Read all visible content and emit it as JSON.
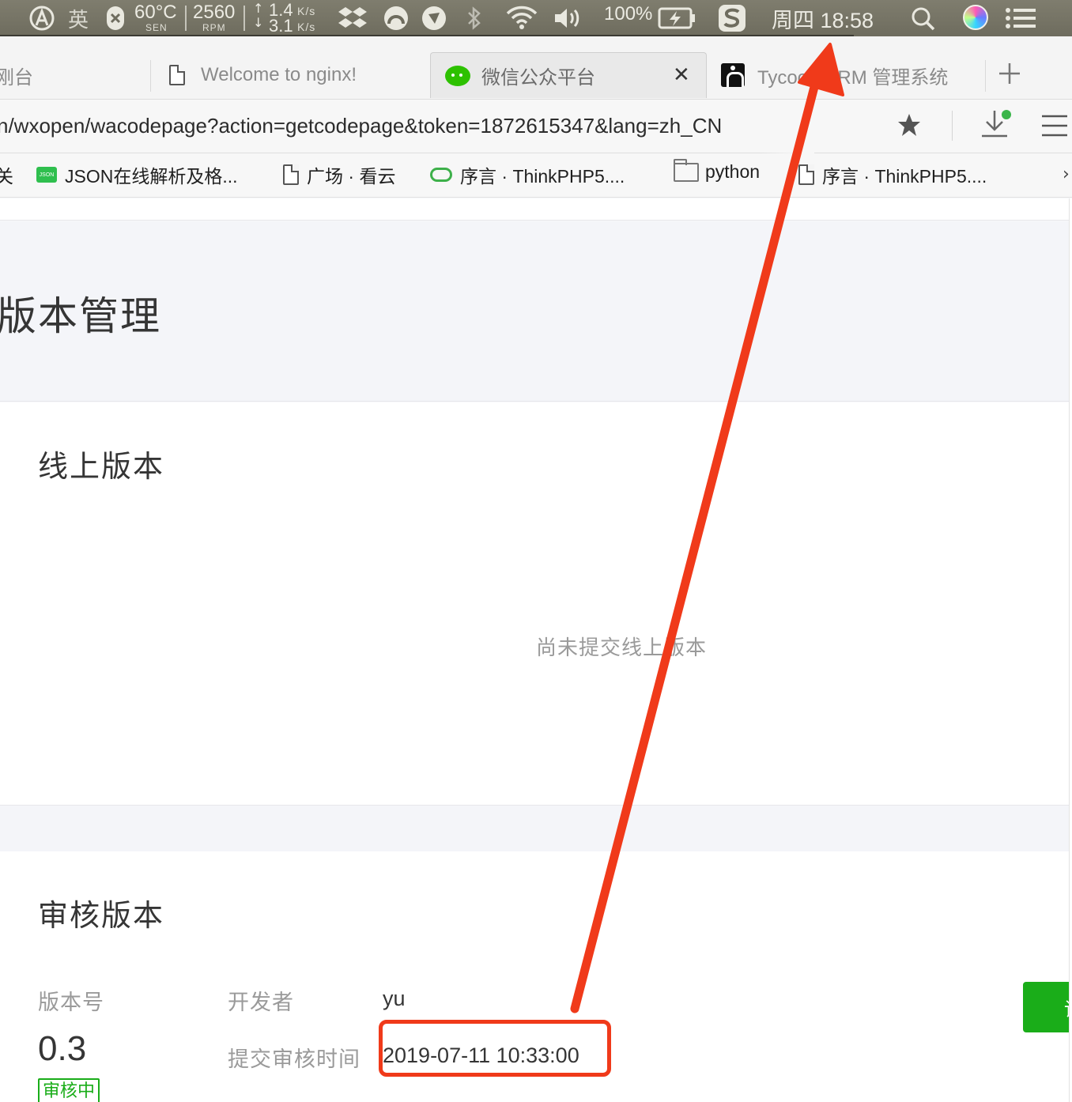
{
  "menubar": {
    "input_method": "英",
    "temperature": "60°C",
    "temperature_sub": "SEN",
    "fan_speed": "2560",
    "fan_sub": "RPM",
    "net_up": "1.4",
    "net_down": "3.1",
    "net_unit": "K/s",
    "battery": "100%",
    "datetime": "周四 18:58",
    "icons": [
      "alfred-icon",
      "close-badge-icon",
      "network-arrows-icon",
      "dropbox-icon",
      "cloud-sync-icon",
      "paw-icon",
      "bluetooth-icon",
      "wifi-icon",
      "volume-icon",
      "battery-charging-icon",
      "sogou-icon",
      "spotlight-search-icon",
      "siri-icon",
      "notification-list-icon"
    ]
  },
  "tabs": [
    {
      "label": "刚台",
      "active": false
    },
    {
      "label": "Welcome to nginx!",
      "active": false
    },
    {
      "label": "微信公众平台",
      "active": true
    },
    {
      "label": "Tycoon CRM 管理系统",
      "active": false
    }
  ],
  "address": {
    "url": "n/wxopen/wacodepage?action=getcodepage&token=1872615347&lang=zh_CN"
  },
  "bookmarks": [
    {
      "label": "关"
    },
    {
      "label": "JSON在线解析及格..."
    },
    {
      "label": "广场 · 看云"
    },
    {
      "label": "序言 · ThinkPHP5...."
    },
    {
      "label": "python"
    },
    {
      "label": "序言 · ThinkPHP5...."
    }
  ],
  "page": {
    "title": "版本管理",
    "online": {
      "title": "线上版本",
      "empty_tip": "尚未提交线上版本"
    },
    "review": {
      "title": "审核版本",
      "version_label": "版本号",
      "version": "0.3",
      "status": "审核中",
      "developer_label": "开发者",
      "developer": "yu",
      "submit_time_label": "提交审核时间",
      "submit_time": "2019-07-11 10:33:00",
      "action_button": "详"
    }
  },
  "colors": {
    "accent_green": "#1aad19",
    "annotation_red": "#f03a1a",
    "menubar": "#7a786a"
  }
}
